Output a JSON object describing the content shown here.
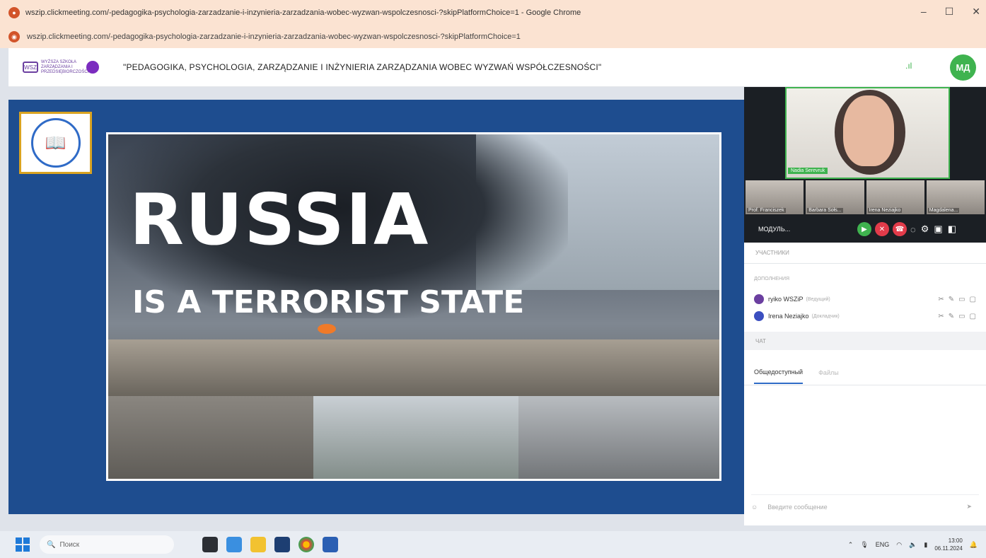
{
  "browser": {
    "window_title": "wszip.clickmeeting.com/-pedagogika-psychologia-zarzadzanie-i-inzynieria-zarzadzania-wobec-wyzwan-wspolczesnosci-?skipPlatformChoice=1 - Google Chrome",
    "url": "wszip.clickmeeting.com/-pedagogika-psychologia-zarzadzanie-i-inzynieria-zarzadzania-wobec-wyzwan-wspolczesnosci-?skipPlatformChoice=1"
  },
  "header": {
    "logo_text": "WYŻSZA SZKOŁA ZARZĄDZANIA I PRZEDSIĘBIORCZOŚCI",
    "conference_title": "\"PEDAGOGIKA, PSYCHOLOGIA, ZARZĄDZANIE I INŻYNIERIA ZARZĄDZANIA WOBEC WYZWAŃ WSPÓŁCZESNOŚCI\"",
    "avatar_initials": "МД",
    "signal_icon": "signal-icon"
  },
  "slide": {
    "headline": "RUSSIA",
    "subline": "IS A TERRORIST STATE"
  },
  "video": {
    "speaker_name": "Nadia Serevruk",
    "thumbnails": [
      "Prof. Franciszek",
      "Barbara Sołs...",
      "Irena Neziajko",
      "Magdalena..."
    ],
    "control_label": "МОДУЛЬ..."
  },
  "participants": {
    "header_label": "УЧАСТНИКИ",
    "section_label": "ДОПОЛНЕНИЯ",
    "rows": [
      {
        "name": "ryiko WSZiP",
        "role": "(Ведущий)"
      },
      {
        "name": "Irena Neziajko",
        "role": "(Докладчик)"
      }
    ]
  },
  "chat": {
    "header_label": "ЧАТ",
    "tab_public": "Общедоступный",
    "tab_files": "Файлы",
    "input_placeholder": "Введите сообщение"
  },
  "taskbar": {
    "search_placeholder": "Поиск",
    "lang": "ENG",
    "time": "13:00",
    "date": "06.11.2024"
  },
  "colors": {
    "accent_green": "#3fb34f",
    "stage_blue": "#1e4d8f",
    "brand_purple": "#6b3fa0"
  }
}
